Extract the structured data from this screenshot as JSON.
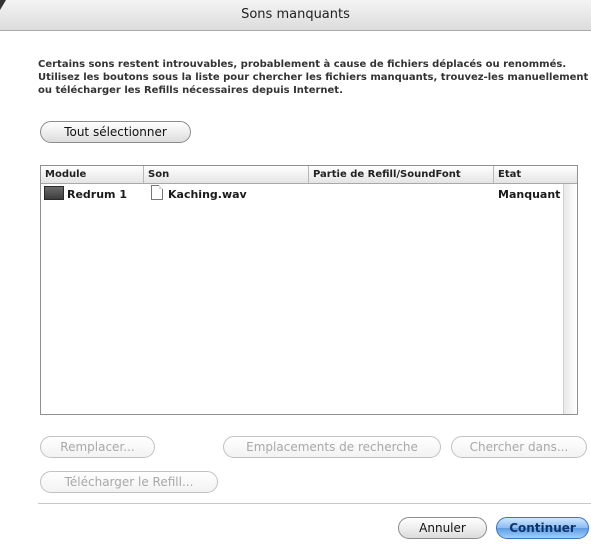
{
  "window": {
    "title": "Sons manquants"
  },
  "message": {
    "line1": "Certains sons restent introuvables, probablement à cause de fichiers déplacés ou renommés.",
    "line2": "Utilisez les boutons sous la liste pour chercher les fichiers manquants, trouvez-les manuellement",
    "line3": "ou télécharger les Refills nécessaires depuis Internet."
  },
  "buttons": {
    "select_all": "Tout sélectionner",
    "replace": "Remplacer...",
    "search_locations": "Emplacements de recherche",
    "search_in": "Chercher dans...",
    "download_refill": "Télécharger le Refill...",
    "cancel": "Annuler",
    "continue": "Continuer"
  },
  "table": {
    "columns": [
      "Module",
      "Son",
      "Partie de Refill/SoundFont",
      "Etat"
    ],
    "rows": [
      {
        "module": "Redrum 1",
        "sound": "Kaching.wav",
        "refill": "",
        "state": "Manquant"
      }
    ]
  },
  "icons": {
    "module": "redrum-module-icon",
    "file": "audio-file-icon"
  },
  "colors": {
    "default_button": "#5e9be0",
    "disabled_text": "#a8a8a8"
  }
}
